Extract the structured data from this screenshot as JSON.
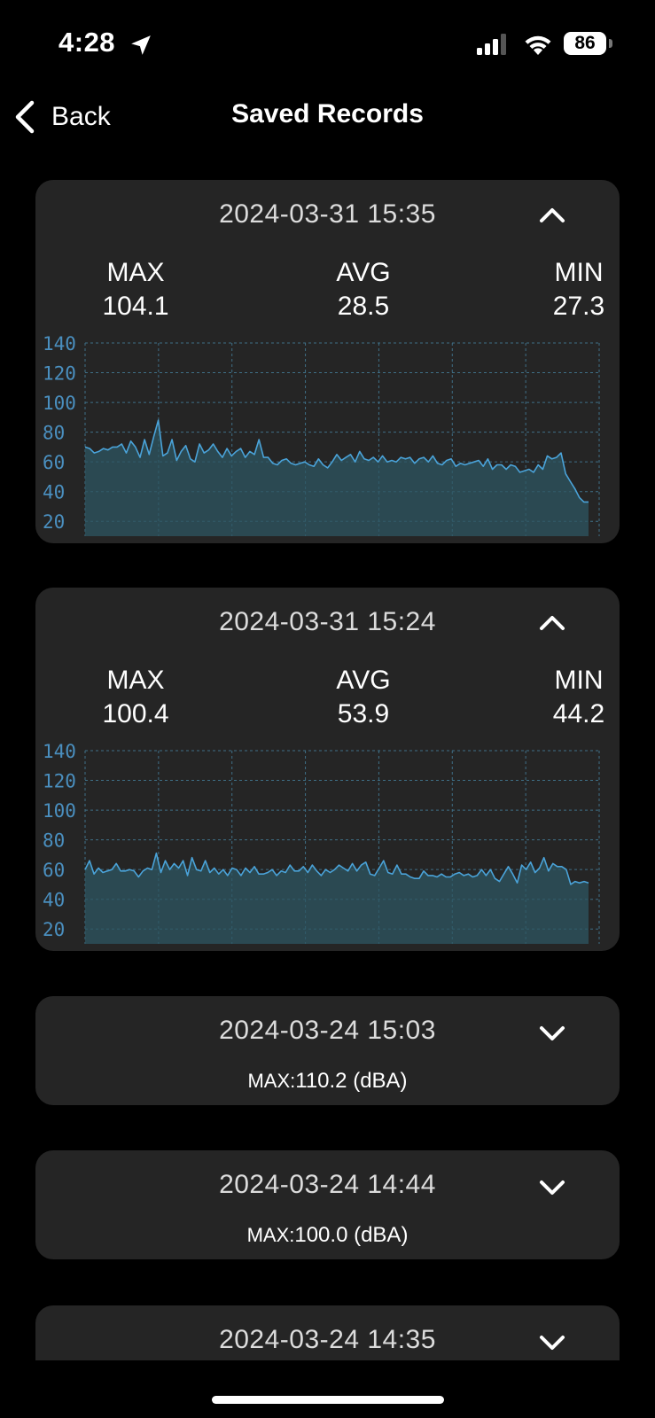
{
  "status": {
    "time": "4:28",
    "battery": "86"
  },
  "nav": {
    "back_label": "Back",
    "title": "Saved Records"
  },
  "records": [
    {
      "date": "2024-03-31 15:35",
      "expanded": true,
      "max_label": "MAX",
      "max_value": "104.1",
      "avg_label": "AVG",
      "avg_value": "28.5",
      "min_label": "MIN",
      "min_value": "27.3"
    },
    {
      "date": "2024-03-31 15:24",
      "expanded": true,
      "max_label": "MAX",
      "max_value": "100.4",
      "avg_label": "AVG",
      "avg_value": "53.9",
      "min_label": "MIN",
      "min_value": "44.2"
    },
    {
      "date": "2024-03-24 15:03",
      "expanded": false,
      "summary_label": "MAX:",
      "summary_value": "110.2 (dBA)"
    },
    {
      "date": "2024-03-24 14:44",
      "expanded": false,
      "summary_label": "MAX:",
      "summary_value": "100.0 (dBA)"
    },
    {
      "date": "2024-03-24 14:35",
      "expanded": false
    }
  ],
  "chart_data": [
    {
      "type": "area",
      "ylim": [
        10,
        140
      ],
      "yticks": [
        "140",
        "120",
        "100",
        "80",
        "60",
        "40",
        "20"
      ],
      "grid": true,
      "line_color": "#4aa3d9",
      "fill_color": "#2e5561",
      "values": [
        70,
        69,
        66,
        67,
        69,
        68,
        70,
        70,
        72,
        66,
        74,
        70,
        63,
        75,
        65,
        77,
        88,
        64,
        66,
        75,
        61,
        67,
        71,
        62,
        60,
        72,
        66,
        68,
        72,
        67,
        63,
        69,
        64,
        67,
        69,
        63,
        67,
        65,
        75,
        63,
        63,
        59,
        58,
        61,
        62,
        59,
        58,
        59,
        60,
        58,
        57,
        62,
        58,
        56,
        60,
        65,
        61,
        63,
        65,
        60,
        67,
        62,
        61,
        63,
        60,
        64,
        60,
        61,
        60,
        63,
        62,
        63,
        59,
        62,
        63,
        60,
        64,
        59,
        58,
        61,
        62,
        57,
        59,
        58,
        59,
        60,
        61,
        57,
        62,
        55,
        58,
        58,
        55,
        58,
        57,
        53,
        54,
        55,
        53,
        58,
        55,
        64,
        62,
        63,
        66,
        52,
        47,
        42,
        36,
        33,
        33
      ]
    },
    {
      "type": "area",
      "ylim": [
        10,
        140
      ],
      "yticks": [
        "140",
        "120",
        "100",
        "80",
        "60",
        "40",
        "20"
      ],
      "grid": true,
      "line_color": "#4aa3d9",
      "fill_color": "#2e5561",
      "values": [
        60,
        66,
        57,
        61,
        58,
        59,
        60,
        64,
        59,
        59,
        60,
        59,
        55,
        59,
        61,
        60,
        71,
        58,
        66,
        60,
        64,
        61,
        66,
        56,
        68,
        60,
        59,
        66,
        58,
        61,
        57,
        60,
        56,
        61,
        60,
        56,
        61,
        58,
        62,
        57,
        57,
        58,
        60,
        56,
        59,
        58,
        63,
        59,
        59,
        62,
        58,
        63,
        59,
        56,
        60,
        58,
        60,
        63,
        61,
        59,
        64,
        59,
        63,
        65,
        57,
        56,
        61,
        66,
        58,
        57,
        63,
        57,
        57,
        55,
        54,
        54,
        59,
        56,
        56,
        55,
        57,
        55,
        55,
        57,
        58,
        56,
        57,
        55,
        56,
        60,
        56,
        60,
        54,
        52,
        57,
        62,
        57,
        51,
        63,
        60,
        65,
        58,
        61,
        68,
        59,
        64,
        62,
        62,
        60,
        50,
        52,
        51,
        52,
        51
      ]
    }
  ]
}
